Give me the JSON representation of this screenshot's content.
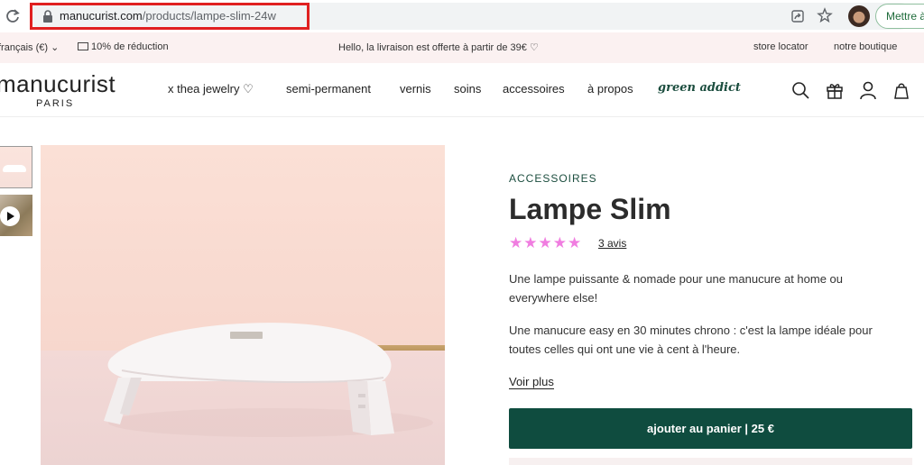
{
  "browser": {
    "url_domain": "manucurist.com",
    "url_path": "/products/lampe-slim-24w",
    "update_label": "Mettre à"
  },
  "promo": {
    "language": "français (€)",
    "discount": "10% de réduction",
    "shipping_message": "Hello, la livraison est offerte à partir de 39€",
    "store_locator": "store locator",
    "our_shop": "notre boutique"
  },
  "header": {
    "logo": "manucurist",
    "logo_sub": "PARIS",
    "nav": [
      "x thea jewelry",
      "semi-permanent",
      "vernis",
      "soins",
      "accessoires",
      "à propos"
    ],
    "nav_special": "green addict",
    "icons": [
      "search-icon",
      "gift-icon",
      "user-icon",
      "bag-icon"
    ]
  },
  "product": {
    "category": "ACCESSOIRES",
    "title": "Lampe Slim",
    "rating": 5,
    "stars": "★★★★★",
    "reviews": "3 avis",
    "description_1": "Une lampe puissante & nomade pour une manucure at home ou everywhere else!",
    "description_2": "Une manucure easy en 30 minutes chrono : c'est la lampe idéale pour toutes celles qui ont une vie à cent à l'heure.",
    "see_more": "Voir plus",
    "add_to_cart": "ajouter au panier  |  25 €"
  },
  "colors": {
    "brand_green": "#0f4c3f",
    "promo_bg": "#fbf1f1",
    "star_pink": "#f07de0",
    "url_highlight": "#e02020"
  }
}
